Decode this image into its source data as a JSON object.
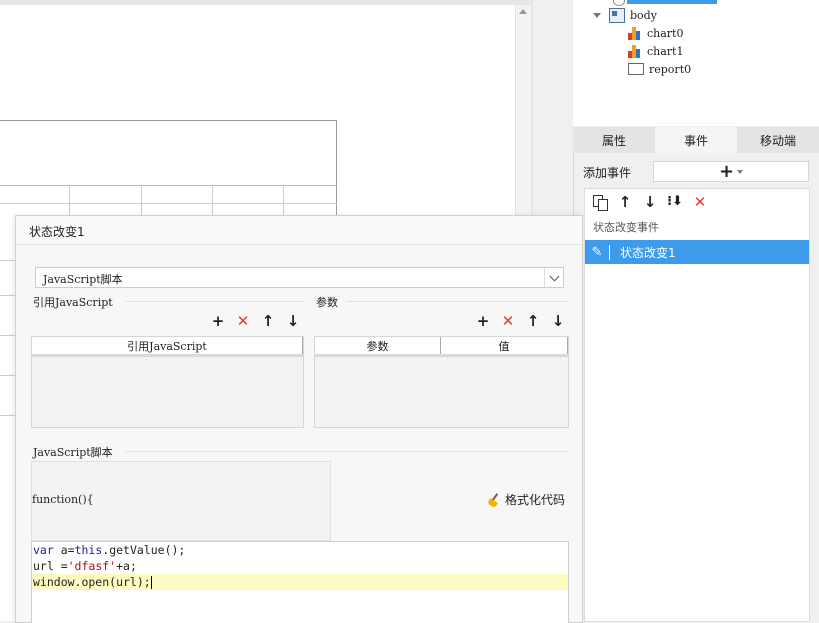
{
  "tree": {
    "items": [
      {
        "label": "body",
        "icon": "body-icon"
      },
      {
        "label": "chart0",
        "icon": "chart-icon"
      },
      {
        "label": "chart1",
        "icon": "chart-icon"
      },
      {
        "label": "report0",
        "icon": "report-icon"
      }
    ]
  },
  "tabs": [
    {
      "label": "属性"
    },
    {
      "label": "事件",
      "active": true
    },
    {
      "label": "移动端"
    }
  ],
  "events": {
    "add_label": "添加事件",
    "add_button": "+",
    "group_label": "状态改变事件",
    "items": [
      {
        "label": "状态改变1",
        "selected": true
      }
    ]
  },
  "dialog": {
    "title": "状态改变1",
    "type_select": "JavaScript脚本",
    "ref_js_label": "引用JavaScript",
    "params_label": "参数",
    "ref_js_header": "引用JavaScript",
    "param_header": "参数",
    "value_header": "值",
    "script_label": "JavaScript脚本",
    "function_head": "function(){",
    "format_button": "格式化代码",
    "code": {
      "line1_kw1": "var",
      "line1_mid": " a=",
      "line1_kw2": "this",
      "line1_end": ".getValue();",
      "line2_start": "url =",
      "line2_str": "'dfasf'",
      "line2_end": "+a;",
      "line3": "window.open(url);"
    }
  },
  "colors": {
    "selected_bg": "#3d9bea",
    "delete_red": "#e03a3a",
    "highlight_line": "#fdfbc2"
  }
}
